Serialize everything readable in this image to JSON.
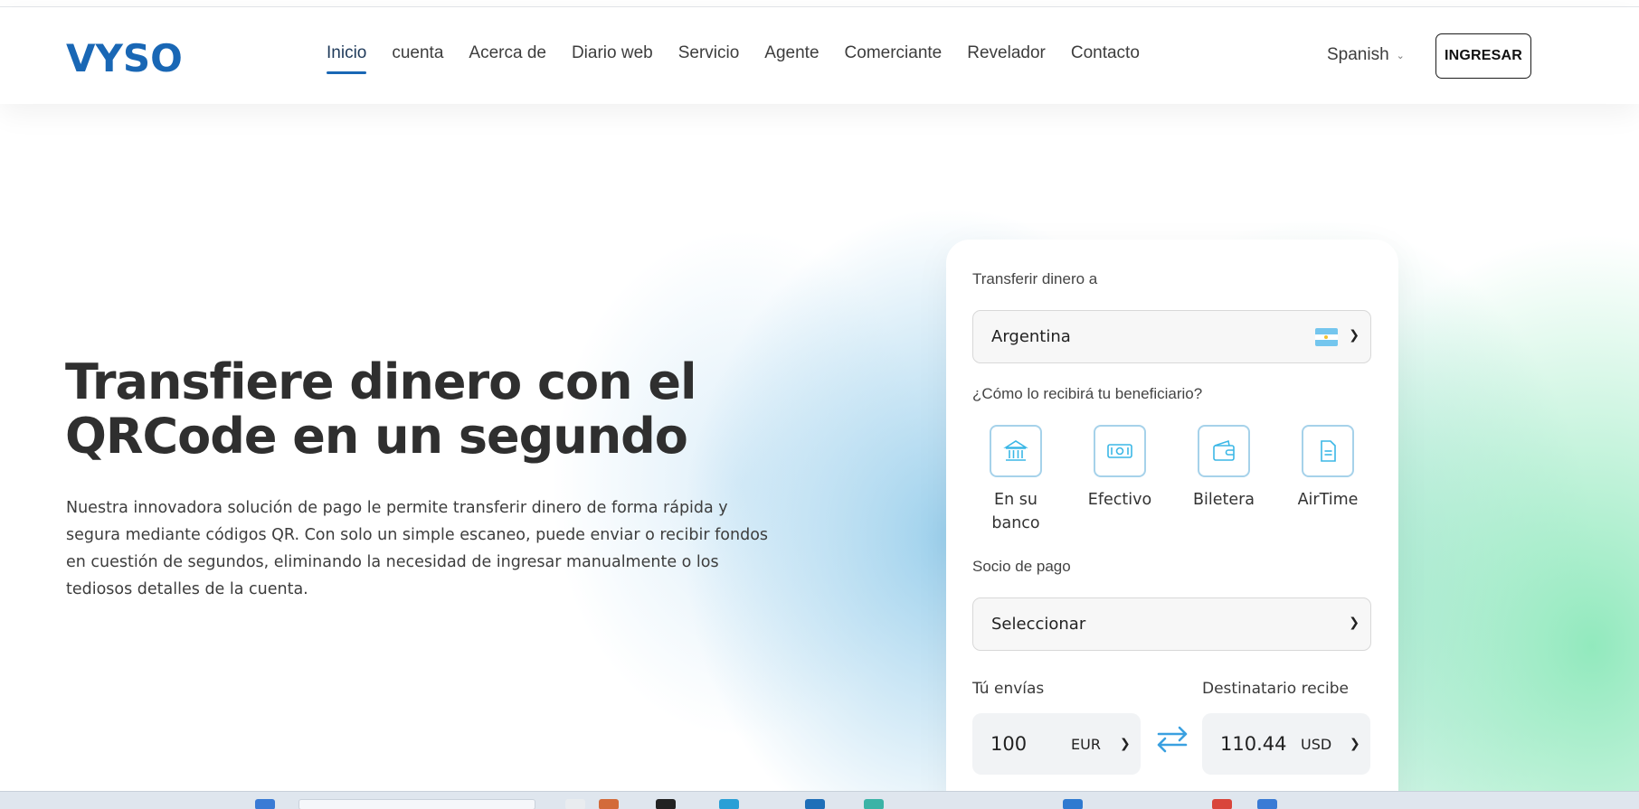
{
  "header": {
    "logo": "VYSO",
    "nav": [
      "Inicio",
      "cuenta",
      "Acerca de",
      "Diario web",
      "Servicio",
      "Agente",
      "Comerciante",
      "Revelador",
      "Contacto"
    ],
    "active_nav": "Inicio",
    "language": "Spanish",
    "login_label": "INGRESAR"
  },
  "hero": {
    "title_line1": "Transfiere dinero con el",
    "title_line2": "QRCode en un segundo",
    "description": "Nuestra innovadora solución de pago le permite transferir dinero de forma rápida y segura mediante códigos QR. Con solo un simple escaneo, puede enviar o recibir fondos en cuestión de segundos, eliminando la necesidad de ingresar manualmente o los tediosos detalles de la cuenta."
  },
  "transfer_card": {
    "country_label": "Transferir dinero a",
    "country_value": "Argentina",
    "method_label": "¿Cómo lo recibirá tu beneficiario?",
    "methods": [
      {
        "label": "En su banco",
        "icon": "bank-icon"
      },
      {
        "label": "Efectivo",
        "icon": "cash-icon"
      },
      {
        "label": "Biletera",
        "icon": "wallet-icon"
      },
      {
        "label": "AirTime",
        "icon": "phone-document-icon"
      }
    ],
    "partner_label": "Socio de pago",
    "partner_value": "Seleccionar",
    "send_label": "Tú envías",
    "send_amount": "100",
    "send_currency": "EUR",
    "receive_label": "Destinatario recibe",
    "receive_amount": "110.44",
    "receive_currency": "USD"
  },
  "colors": {
    "brand": "#1967b5",
    "icon_accent": "#3bb7e6",
    "swap_arrows": "#3aa0e0"
  }
}
